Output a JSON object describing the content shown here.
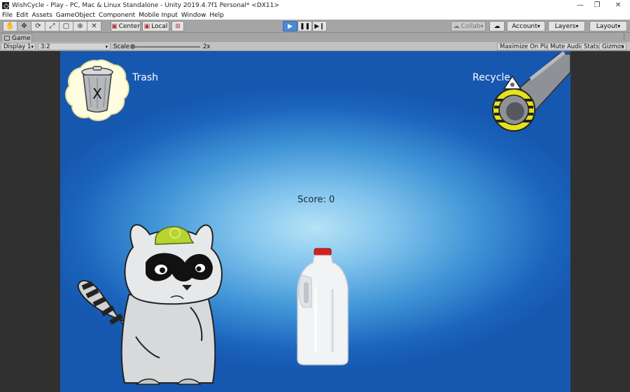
{
  "window": {
    "title": "WishCycle - Play - PC, Mac & Linux Standalone - Unity 2019.4.7f1 Personal* <DX11>",
    "controls": {
      "minimize": "—",
      "restore": "❐",
      "close": "✕"
    }
  },
  "menu": [
    "File",
    "Edit",
    "Assets",
    "GameObject",
    "Component",
    "Mobile Input",
    "Window",
    "Help"
  ],
  "toolbar": {
    "pivot_label": "Center",
    "space_label": "Local",
    "collab_label": "Collab",
    "account_label": "Account",
    "layers_label": "Layers",
    "layout_label": "Layout"
  },
  "tab": {
    "label": "Game",
    "menu": "⋮"
  },
  "gamebar": {
    "display": "Display 1",
    "aspect": "3:2",
    "scale_label": "Scale",
    "scale_value": "2x",
    "scale_fraction": 0.02,
    "maximize": "Maximize On Play",
    "mute": "Mute Audio",
    "stats": "Stats",
    "gizmos": "Gizmos"
  },
  "game": {
    "trash_label": "Trash",
    "trash_can_mark": "X",
    "recycle_label": "Recycle",
    "score_text": "Score: 0"
  },
  "colors": {
    "sky_center": "#b6e3f6",
    "sky_edge": "#1658b0",
    "play_active": "#4a8ad4",
    "helmet": "#b8d432",
    "milk_cap": "#d42020"
  }
}
